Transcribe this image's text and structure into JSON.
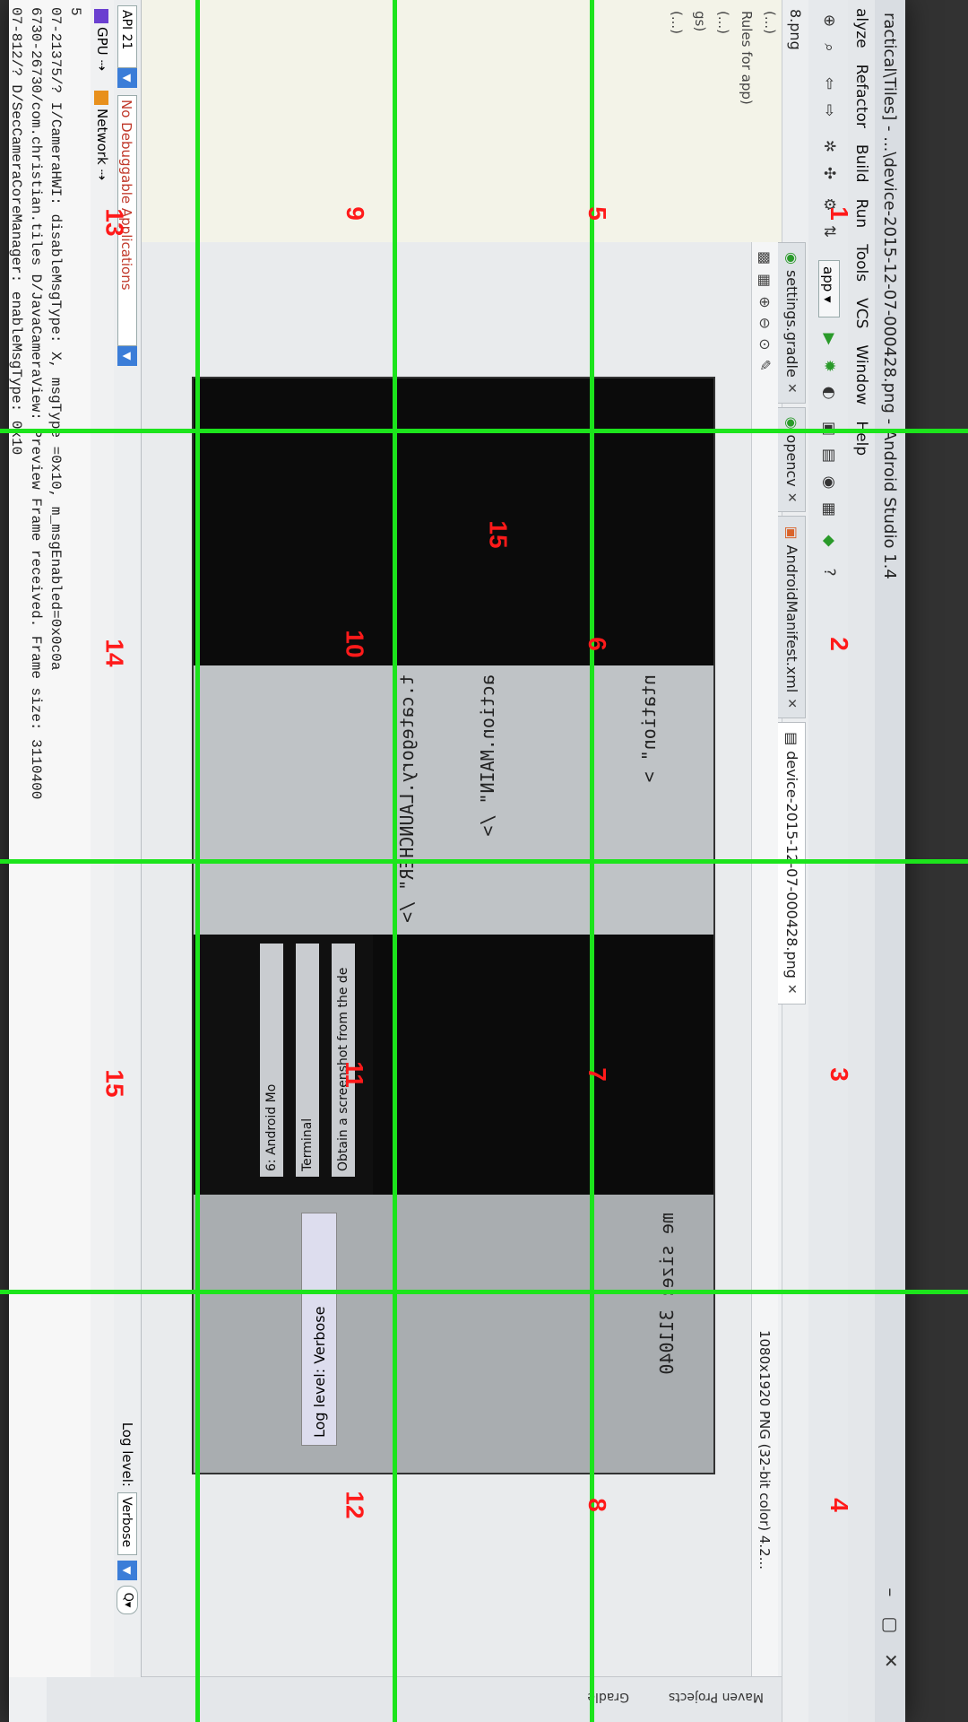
{
  "window": {
    "title": "ractical\\Tiles] - ...\\device-2015-12-07-000428.png - Android Studio 1.4",
    "controls": [
      "–",
      "▢",
      "✕"
    ]
  },
  "menu": [
    "alyze",
    "Refactor",
    "Build",
    "Run",
    "Tools",
    "VCS",
    "Window",
    "Help"
  ],
  "toolbar": {
    "app_label": "app"
  },
  "breadcrumb": "8.png",
  "project_panel": [
    "(...)",
    "Rules for app)",
    "(...)",
    "gs)",
    "(...)"
  ],
  "tabs": [
    {
      "label": "settings.gradle"
    },
    {
      "label": "opencv"
    },
    {
      "label": "AndroidManifest.xml"
    },
    {
      "label": "device-2015-12-07-000428.png"
    }
  ],
  "image_info": "1080x1920 PNG (32-bit color) 4.2...",
  "side_tabs": [
    "Maven Projects",
    "Gradle"
  ],
  "photo": {
    "code_lines": [
      "ntation\" >",
      "action.MAIN\" />",
      "t.category.LAUNCHER\" />"
    ],
    "log_level_label": "Log level:",
    "log_level_value": "Verbose",
    "log_snippet": "me size: 311040",
    "task_buttons": [
      "Obtain a screenshot from the de",
      "Terminal",
      "6: Android Mo"
    ]
  },
  "devices_bar": {
    "api": "API 21",
    "debug_apps": "No Debuggable Applications",
    "log_level_label": "Log level:",
    "log_level_value": "Verbose",
    "search_icon": "Q▾"
  },
  "monitors": [
    "GPU",
    "Network"
  ],
  "logcat": [
    "5",
    "07-21375/? I/CameraHWI: disableMsgType: X, msgType =0x10, m_msgEnabled=0x0c0a",
    "6730-26730/com.christian.tiles D/JavaCameraView: Preview Frame received. Frame size: 3110400",
    "07-812/? D/SecCameraCoreManager: enableMsgType: 0x10",
    "... msgType =0x10"
  ],
  "grid_labels": [
    "1",
    "2",
    "3",
    "4",
    "5",
    "6",
    "7",
    "8",
    "9",
    "10",
    "11",
    "12",
    "13",
    "14",
    "15",
    "15"
  ],
  "colors": {
    "grid": "#1ce41c",
    "labels": "#ff1a1a",
    "dropdown": "#3b7dd8"
  }
}
